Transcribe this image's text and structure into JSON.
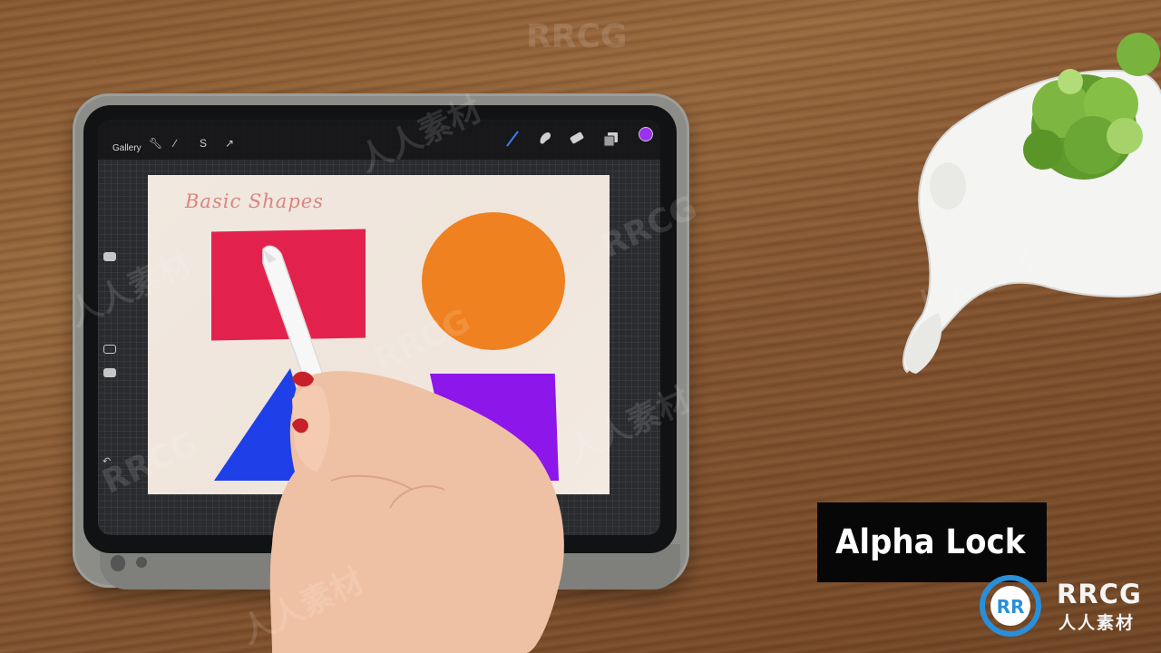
{
  "app": {
    "gallery_label": "Gallery",
    "toolbar_left_icons": [
      "wrench-icon",
      "magic-wand-icon",
      "selection-icon",
      "transform-arrow-icon"
    ],
    "toolbar_right_icons": [
      "brush-icon",
      "smudge-icon",
      "eraser-icon",
      "layers-icon"
    ],
    "current_color": "#9b2ff2"
  },
  "canvas": {
    "title": "Basic Shapes",
    "shape_colors": {
      "rectangle": "#e2224c",
      "circle": "#ef8120",
      "triangle": "#1f40e8",
      "trapezoid": "#8d16ea"
    }
  },
  "caption": {
    "text": "Alpha Lock"
  },
  "branding": {
    "logo_text": "RRCG",
    "logo_subtext": "人人素材",
    "watermark_text": "RRCG",
    "watermark_cn": "人人素材",
    "accent_color": "#2a8fd8"
  }
}
